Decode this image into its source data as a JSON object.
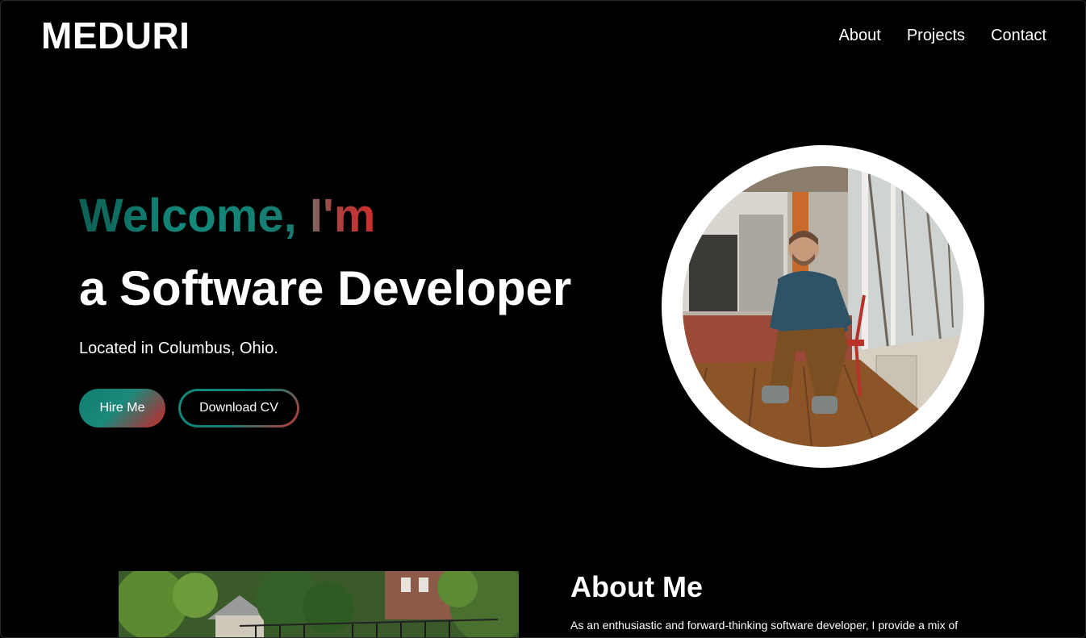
{
  "header": {
    "logo": "MEDURI",
    "nav": [
      {
        "label": "About"
      },
      {
        "label": "Projects"
      },
      {
        "label": "Contact"
      }
    ]
  },
  "hero": {
    "welcome": "Welcome,",
    "im": "I'm",
    "role": "a Software Developer",
    "location": "Located in Columbus, Ohio.",
    "hire_label": "Hire Me",
    "cv_label": "Download CV"
  },
  "about": {
    "title": "About Me",
    "text": "As an enthusiastic and forward-thinking software developer, I provide a mix of creativity, innovation, and dedication with extensive leadership"
  },
  "colors": {
    "background": "#000000",
    "accent_teal": "#0f7d71",
    "accent_red": "#c53333"
  }
}
